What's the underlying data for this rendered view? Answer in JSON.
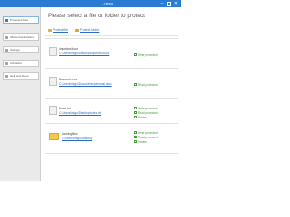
{
  "window": {
    "title": "...nesto",
    "controls": {
      "minimize": "–",
      "close": "✕"
    }
  },
  "sidebar": {
    "items": [
      {
        "label": "Protected Files",
        "icon": "lock-icon",
        "active": true
      },
      {
        "label": "Allowed Applications",
        "icon": "app-icon",
        "active": false
      },
      {
        "label": "Settings",
        "icon": "gear-icon",
        "active": false
      },
      {
        "label": "Activation",
        "icon": "key-icon",
        "active": false
      },
      {
        "label": "Help and About",
        "icon": "help-icon",
        "active": false
      }
    ]
  },
  "main": {
    "heading": "Please select a file or folder to protect",
    "toolbar": {
      "protect_file": "Protect file",
      "protect_folder": "Protect folder"
    },
    "items": [
      {
        "name": "Important.docx",
        "path": "C:\\Users\\imigo\\Desktop\\important.docx",
        "type": "file",
        "statuses": [
          "Write protected"
        ]
      },
      {
        "name": "Personal.docx",
        "path": "C:\\Users\\imigo\\Documents\\personal.docx",
        "type": "file",
        "statuses": [
          "Read protected"
        ]
      },
      {
        "name": "Notes.txt",
        "path": "C:\\Users\\imigo\\Desktop\\notes.txt",
        "type": "file",
        "statuses": [
          "Write protected",
          "Read protected",
          "Hidden"
        ]
      },
      {
        "name": "Locking files",
        "path": "C:\\Users\\imigo\\Desktop",
        "type": "folder",
        "statuses": [
          "Write protected",
          "Read protected",
          "Hidden"
        ]
      }
    ]
  },
  "colors": {
    "titlebar": "#2b7bd4",
    "link": "#2b6cc4",
    "status_ok": "#4a9a3f",
    "sidebar_bg": "#eaeaea"
  }
}
